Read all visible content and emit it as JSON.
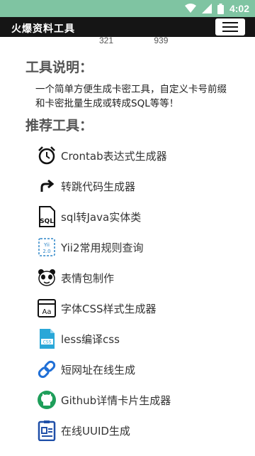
{
  "status": {
    "time": "4:02"
  },
  "appbar": {
    "title": "火爆资料工具"
  },
  "top_numbers": [
    "321",
    "939"
  ],
  "intro": {
    "heading": "工具说明：",
    "text": "一个简单方便生成卡密工具，自定义卡号前缀和卡密批量生成或转成SQL等等！"
  },
  "tools": {
    "heading": "推荐工具：",
    "items": [
      {
        "label": "Crontab表达式生成器",
        "icon": "alarm-clock-icon"
      },
      {
        "label": "转跳代码生成器",
        "icon": "redirect-arrow-icon"
      },
      {
        "label": "sql转Java实体类",
        "icon": "sql-file-icon"
      },
      {
        "label": "Yii2常用规则查询",
        "icon": "yii-icon"
      },
      {
        "label": "表情包制作",
        "icon": "panda-face-icon"
      },
      {
        "label": "字体CSS样式生成器",
        "icon": "font-aa-icon"
      },
      {
        "label": "less编译css",
        "icon": "css-file-icon"
      },
      {
        "label": "短网址在线生成",
        "icon": "link-icon"
      },
      {
        "label": "Github详情卡片生成器",
        "icon": "github-icon"
      },
      {
        "label": "在线UUID生成",
        "icon": "id-card-icon"
      }
    ]
  }
}
